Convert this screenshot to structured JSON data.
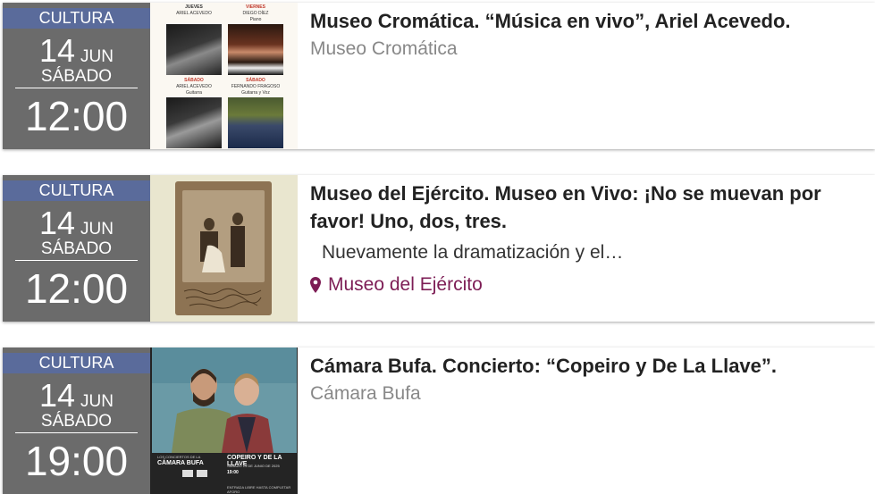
{
  "events": [
    {
      "category": "CULTURA",
      "day": "14",
      "month": "JUN",
      "weekday": "SÁBADO",
      "time": "12:00",
      "title": "Museo Cromática. “Música en vivo”, Ariel Acevedo.",
      "venue": "Museo Cromática",
      "poster": {
        "top_left": "JUEVES",
        "top_left_name": "ARIEL ACEVEDO",
        "top_right": "VIERNES",
        "top_right_name": "DIEGO DÍEZ",
        "top_right_sub": "Piano",
        "bottom_left": "SÁBADO",
        "bottom_left_name": "ARIEL ACEVEDO",
        "bottom_left_sub": "Guitarra",
        "bottom_right": "SÁBADO",
        "bottom_right_name": "FERNANDO FRAGOSO",
        "bottom_right_sub": "Guitarra y Voz"
      }
    },
    {
      "category": "CULTURA",
      "day": "14",
      "month": "JUN",
      "weekday": "SÁBADO",
      "time": "12:00",
      "title": "Museo del Ejército. Museo en Vivo: ¡No se muevan por favor! Uno, dos, tres.",
      "description": "Nuevamente la dramatización y el…",
      "venue": "Museo del Ejército",
      "venue_color": "#7d1d55"
    },
    {
      "category": "CULTURA",
      "day": "14",
      "month": "JUN",
      "weekday": "SÁBADO",
      "time": "19:00",
      "title": "Cámara Bufa. Concierto: “Copeiro y De La Llave”.",
      "venue": "Cámara Bufa",
      "poster": {
        "series": "LOS CONCIERTOS DE LA",
        "brand": "CÁMARA BUFA",
        "headline": "COPEIRO Y DE LA LLAVE",
        "date_line": "SÁBADO 14 DE JUNIO DE 2025",
        "time_line": "19:00",
        "entry": "ENTRADA LIBRE HASTA COMPLETAR AFORO"
      }
    }
  ],
  "colors": {
    "date_panel": "#6b6b6b",
    "category_bar": "#5a6b9b",
    "venue_link": "#7d1d55",
    "venue_muted": "#888888"
  }
}
